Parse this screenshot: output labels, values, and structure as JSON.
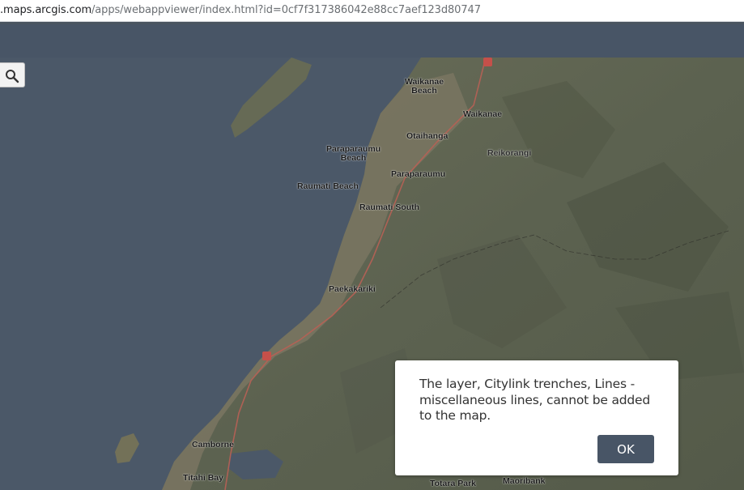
{
  "browser": {
    "url_host": ".maps.arcgis.com",
    "url_path": "/apps/webappviewer/index.html?id=0cf7f317386042e88cc7aef123d80747"
  },
  "map": {
    "search_icon": "magnifier-icon",
    "labels": {
      "waikanae_beach_1": "Waikanae",
      "waikanae_beach_2": "Beach",
      "waikanae": "Waikanae",
      "otaihanga": "Otaihanga",
      "reikorangi": "Reikorangi",
      "paraparaumu_beach_1": "Paraparaumu",
      "paraparaumu_beach_2": "Beach",
      "paraparaumu": "Paraparaumu",
      "raumati_beach": "Raumati Beach",
      "raumati_south": "Raumati South",
      "paekakariki": "Paekakariki",
      "camborne": "Camborne",
      "titahi_bay": "Titahi Bay",
      "totara_park": "Totara Park",
      "maoribank": "Maoribank"
    }
  },
  "dialog": {
    "message": "The layer, Citylink trenches, Lines - miscellaneous lines, cannot be added to the map.",
    "ok_label": "OK"
  },
  "colors": {
    "header": "#485566",
    "water": "#4b5868",
    "land": "#5f6450",
    "button": "#485566"
  }
}
